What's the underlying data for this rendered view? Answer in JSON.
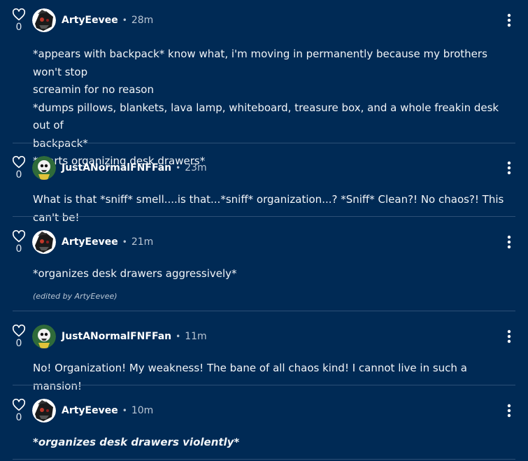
{
  "comments": [
    {
      "likes": "0",
      "username": "ArtyEevee",
      "separator": "•",
      "time": "28m",
      "lines": [
        " *appears with backpack* know what, i'm moving in permanently because my brothers won't stop",
        "screamin for no reason",
        "*dumps pillows, blankets, lava lamp, whiteboard, treasure box, and a whole freakin desk out of",
        "backpack*",
        "*starts organizing desk drawers*"
      ],
      "edited": ""
    },
    {
      "likes": "0",
      "username": "JustANormalFNFFan",
      "separator": "•",
      "time": "23m",
      "lines": [
        "What is that *sniff* smell....is that...*sniff* organization...? *Sniff* Clean?! No chaos?! This can't be!"
      ],
      "edited": ""
    },
    {
      "likes": "0",
      "username": "ArtyEevee",
      "separator": "•",
      "time": "21m",
      "lines": [
        "*organizes desk drawers aggressively*"
      ],
      "edited": "(edited by ArtyEevee)"
    },
    {
      "likes": "0",
      "username": "JustANormalFNFFan",
      "separator": "•",
      "time": "11m",
      "lines": [
        "No! Organization! My weakness! The bane of all chaos kind! I cannot live in such a mansion!"
      ],
      "edited": ""
    },
    {
      "likes": "0",
      "username": "ArtyEevee",
      "separator": "•",
      "time": "10m",
      "lines": [
        "*organizes desk drawers violently*"
      ],
      "edited": ""
    }
  ],
  "colors": {
    "background": "#002a55",
    "divider": "#2c4f76",
    "muted_text": "#b9c6d4"
  },
  "icons": {
    "like": "heart-outline-icon",
    "more": "vertical-ellipsis-icon",
    "avatar_arty": "dark-character-avatar",
    "avatar_fnf": "skull-character-avatar"
  }
}
